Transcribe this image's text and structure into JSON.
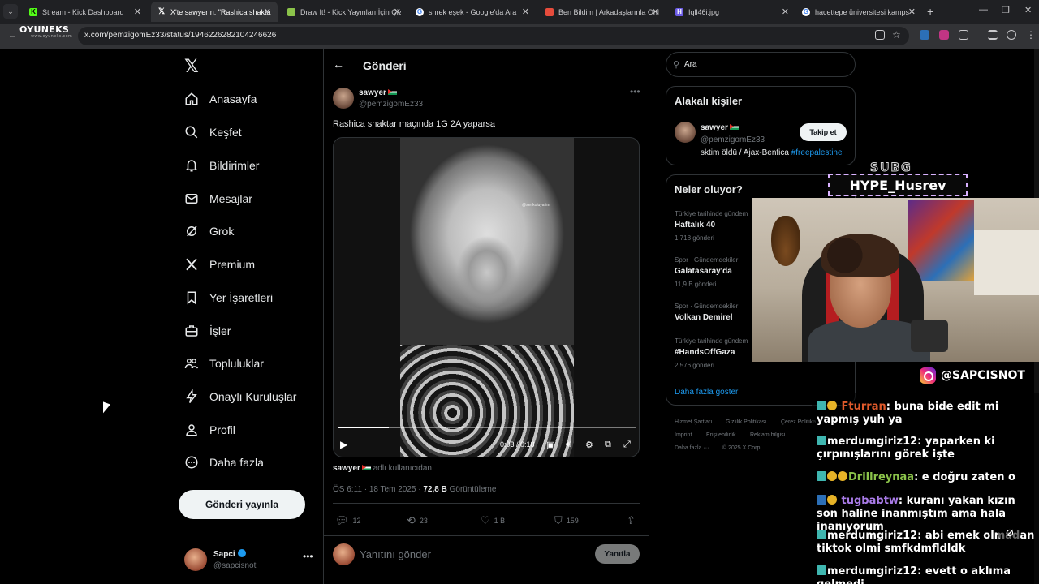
{
  "browser": {
    "tabs": [
      {
        "title": "Stream - Kick Dashboard",
        "icon": "kick-icon",
        "color": "#53fc18"
      },
      {
        "title": "X'te sawyerın: \"Rashica shaktar",
        "icon": "x-icon",
        "color": "#ffffff"
      },
      {
        "title": "Draw It! - Kick Yayınları İçin Çiz",
        "icon": "brush-icon",
        "color": "#8bc34a"
      },
      {
        "title": "shrek eşek - Google'da Ara",
        "icon": "google-icon",
        "color": "#4285f4"
      },
      {
        "title": "Ben Bildim | Arkadaşlarınla Onli",
        "icon": "game-icon",
        "color": "#e74c3c"
      },
      {
        "title": "Iqll46i.jpg",
        "icon": "image-icon",
        "color": "#6c5ce7"
      },
      {
        "title": "hacettepe üniversitesi kamps -",
        "icon": "google-icon",
        "color": "#4285f4"
      }
    ],
    "url": "x.com/pemzigomEz33/status/1946226282104246626",
    "overlay_logo": "OYUNEKS",
    "overlay_logo_sub": "www.oyuneks.com"
  },
  "sidebar": {
    "items": [
      {
        "label": "Anasayfa",
        "icon": "home-icon"
      },
      {
        "label": "Keşfet",
        "icon": "search-icon"
      },
      {
        "label": "Bildirimler",
        "icon": "bell-icon"
      },
      {
        "label": "Mesajlar",
        "icon": "mail-icon"
      },
      {
        "label": "Grok",
        "icon": "grok-icon"
      },
      {
        "label": "Premium",
        "icon": "x-icon"
      },
      {
        "label": "Yer İşaretleri",
        "icon": "bookmark-icon"
      },
      {
        "label": "İşler",
        "icon": "briefcase-icon"
      },
      {
        "label": "Topluluklar",
        "icon": "people-icon"
      },
      {
        "label": "Onaylı Kuruluşlar",
        "icon": "lightning-icon"
      },
      {
        "label": "Profil",
        "icon": "person-icon"
      },
      {
        "label": "Daha fazla",
        "icon": "more-circle-icon"
      }
    ],
    "post_button": "Gönderi yayınla",
    "account": {
      "name": "Sapci",
      "handle": "@sapcisnot"
    }
  },
  "post": {
    "page_title": "Gönderi",
    "author_name": "sawyer",
    "author_handle": "@pemzigomEz33",
    "text": "Rashica shaktar maçında 1G 2A yaparsa",
    "video": {
      "time": "0:03 / 0:18",
      "progress": 0.17,
      "watermark": "@senkoluyarim"
    },
    "from_user_name": "sawyer",
    "from_user_suffix": "adlı kullanıcıdan",
    "time_date": "ÖS 6:11 · 18 Tem 2025 · ",
    "views_value": "72,8 B",
    "views_label": " Görüntüleme",
    "stats": {
      "replies": "12",
      "reposts": "23",
      "likes": "1 B",
      "bookmarks": "159"
    },
    "reply_placeholder": "Yanıtını gönder",
    "reply_button": "Yanıtla"
  },
  "right": {
    "search_placeholder": "Ara",
    "related_title": "Alakalı kişiler",
    "related": {
      "name": "sawyer",
      "handle": "@pemzigomEz33",
      "bio": "sktim öldü / Ajax-Benfica ",
      "bio_tag": "#freepalestine",
      "follow": "Takip et"
    },
    "trends_title": "Neler oluyor?",
    "trends": [
      {
        "category": "Türkiye tarihinde gündem",
        "name": "Haftalık 40",
        "count": "1.718 gönderi"
      },
      {
        "category": "Spor · Gündemdekiler",
        "name": "Galatasaray'da",
        "count": "11,9 B gönderi"
      },
      {
        "category": "Spor · Gündemdekiler",
        "name": "Volkan Demirel",
        "count": ""
      },
      {
        "category": "Türkiye tarihinde gündem",
        "name": "#HandsOffGaza",
        "count": "2.576 gönderi"
      }
    ],
    "show_more": "Daha fazla göster",
    "footer": [
      "Hizmet Şartları",
      "Gizlilik Politikası",
      "Çerez Politika",
      "Imprint",
      "Erişilebilirlik",
      "Reklam bilgisi",
      "Daha fazla ···",
      "© 2025 X Corp."
    ]
  },
  "stream": {
    "sub_label": "SUBG",
    "hype_user": "HYPE_Husrev",
    "instagram": "@SAPCISNOT",
    "chat": [
      {
        "user": "Fturran",
        "text": ": buna bide edit mi yapmış yuh ya",
        "color": "#e05a2b"
      },
      {
        "user": "merdumgiriz12",
        "text": ": yaparken ki çırpınışlarını görek işte",
        "color": "#ffffff"
      },
      {
        "user": "Drillreynaa",
        "text": ": e doğru zaten o",
        "color": "#8bc34a"
      },
      {
        "user": "tugbabtw",
        "text": ": kuranı yakan kızın son haline inanmıştım ama hala inanıyorum",
        "color": "#a97be8"
      },
      {
        "user": "merdumgiriz12",
        "text": ": abi emek olmadan tiktok olmi smfkdmfldldk",
        "color": "#ffffff"
      },
      {
        "user": "merdumgiriz12",
        "text": ": evett o aklıma gelmedi",
        "color": "#ffffff"
      }
    ]
  }
}
